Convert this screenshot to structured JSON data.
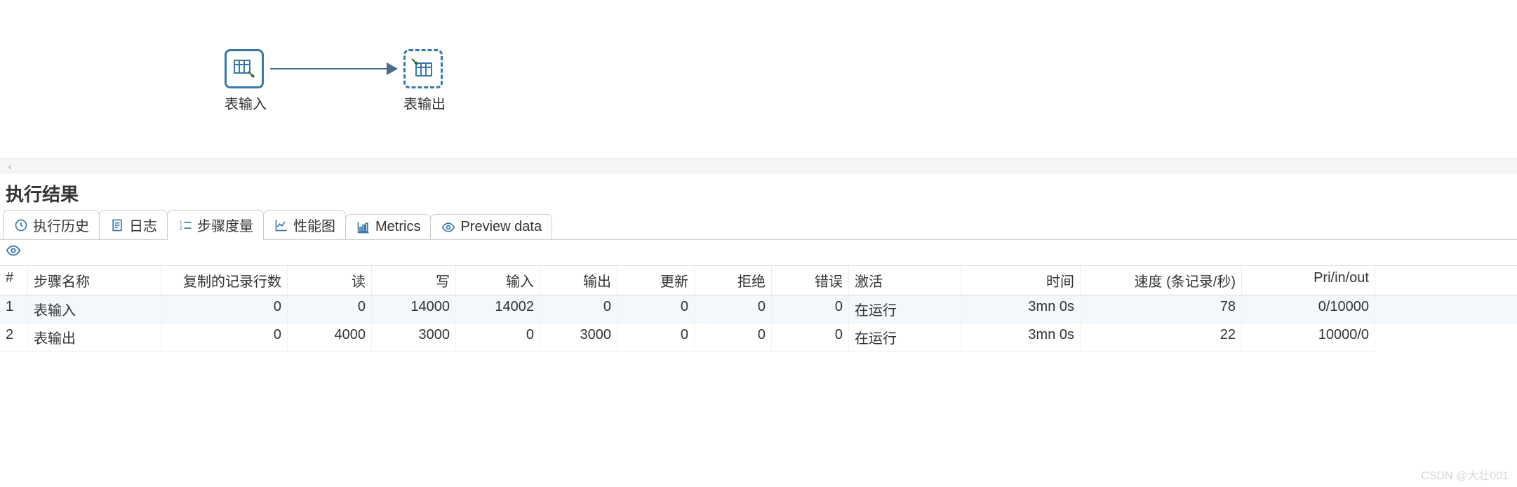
{
  "canvas": {
    "node_input_label": "表输入",
    "node_output_label": "表输出"
  },
  "section_title": "执行结果",
  "tabs": {
    "history": "执行历史",
    "log": "日志",
    "step_metrics": "步骤度量",
    "perf_graph": "性能图",
    "metrics": "Metrics",
    "preview": "Preview data"
  },
  "headers": {
    "hash": "#",
    "step_name": "步骤名称",
    "copied": "复制的记录行数",
    "read": "读",
    "write": "写",
    "input": "输入",
    "output": "输出",
    "update": "更新",
    "reject": "拒绝",
    "errors": "错误",
    "active": "激活",
    "time": "时间",
    "speed": "速度 (条记录/秒)",
    "pri": "Pri/in/out"
  },
  "rows": [
    {
      "idx": "1",
      "step": "表输入",
      "copied": "0",
      "read": "0",
      "write": "14000",
      "input": "14002",
      "output": "0",
      "update": "0",
      "reject": "0",
      "errors": "0",
      "active": "在运行",
      "time": "3mn 0s",
      "speed": "78",
      "pri": "0/10000"
    },
    {
      "idx": "2",
      "step": "表输出",
      "copied": "0",
      "read": "4000",
      "write": "3000",
      "input": "0",
      "output": "3000",
      "update": "0",
      "reject": "0",
      "errors": "0",
      "active": "在运行",
      "time": "3mn 0s",
      "speed": "22",
      "pri": "10000/0"
    }
  ],
  "watermark": "CSDN @大壮001"
}
